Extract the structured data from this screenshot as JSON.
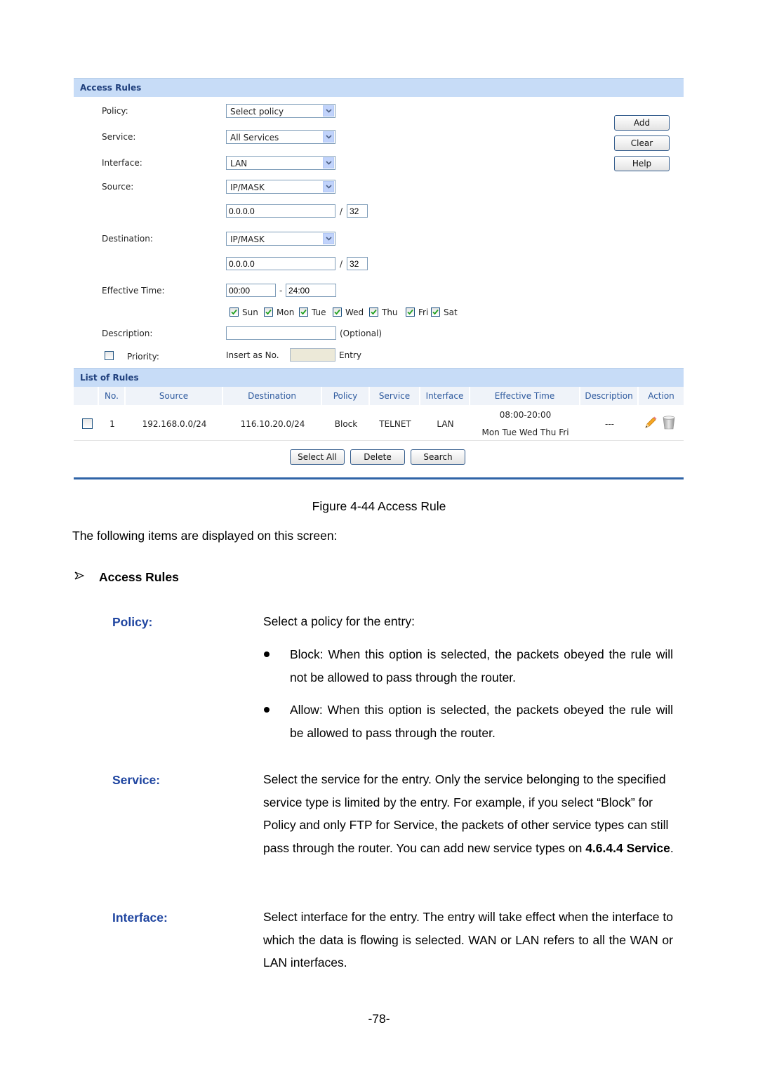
{
  "panel": {
    "access_rules_title": "Access Rules",
    "labels": {
      "policy": "Policy:",
      "service": "Service:",
      "interface": "Interface:",
      "source": "Source:",
      "destination": "Destination:",
      "effective_time": "Effective Time:",
      "description": "Description:",
      "priority": "Priority:"
    },
    "policy_select": "Select policy",
    "service_select": "All Services",
    "interface_select": "LAN",
    "source_select": "IP/MASK",
    "source_ip": "0.0.0.0",
    "source_mask": "32",
    "destination_select": "IP/MASK",
    "destination_ip": "0.0.0.0",
    "destination_mask": "32",
    "time_start": "00:00",
    "time_separator": "-",
    "time_end": "24:00",
    "slash": "/",
    "days": [
      {
        "label": "Sun",
        "checked": true
      },
      {
        "label": "Mon",
        "checked": true
      },
      {
        "label": "Tue",
        "checked": true
      },
      {
        "label": "Wed",
        "checked": true
      },
      {
        "label": "Thu",
        "checked": true
      },
      {
        "label": "Fri",
        "checked": true
      },
      {
        "label": "Sat",
        "checked": true
      }
    ],
    "description_value": "",
    "optional_hint": "(Optional)",
    "priority_checked": false,
    "insert_as_label": "Insert as No.",
    "insert_value": "",
    "entry_label": "Entry",
    "buttons": {
      "add": "Add",
      "clear": "Clear",
      "help": "Help"
    }
  },
  "rules_list": {
    "title": "List of Rules",
    "columns": [
      "No.",
      "Source",
      "Destination",
      "Policy",
      "Service",
      "Interface",
      "Effective Time",
      "Description",
      "Action"
    ],
    "rows": [
      {
        "no": "1",
        "source": "192.168.0.0/24",
        "destination": "116.10.20.0/24",
        "policy": "Block",
        "service": "TELNET",
        "interface": "LAN",
        "time": "08:00-20:00",
        "days": "Mon Tue Wed Thu Fri",
        "description": "---",
        "actions": [
          "edit-icon",
          "delete-icon"
        ]
      }
    ],
    "buttons": {
      "select_all": "Select All",
      "delete": "Delete",
      "search": "Search"
    }
  },
  "document": {
    "caption": "Figure 4-44 Access Rule",
    "intro": "The following items are displayed on this screen:",
    "section_heading": "Access Rules",
    "items": [
      {
        "term": "Policy:",
        "text": "Select a policy for the entry:",
        "bullets": [
          "Block: When this option is selected, the packets obeyed the rule will not be allowed to pass through the router.",
          "Allow: When this option is selected, the packets obeyed the rule will be allowed to pass through the router."
        ]
      },
      {
        "term": "Service:",
        "text": "Select the service for the entry. Only the service belonging to the specified service type is limited by the entry. For example, if you select “Block” for Policy and only FTP for Service, the packets of other service types can still pass through the router. You can add new service types on ",
        "link": "4.6.4.4 Service",
        "text_end": "."
      },
      {
        "term": "Interface:",
        "text": "Select interface for the entry. The entry will take effect when the interface to which the data is flowing is selected. WAN or LAN refers to all the WAN or LAN interfaces."
      }
    ],
    "page_number": "-78-"
  }
}
